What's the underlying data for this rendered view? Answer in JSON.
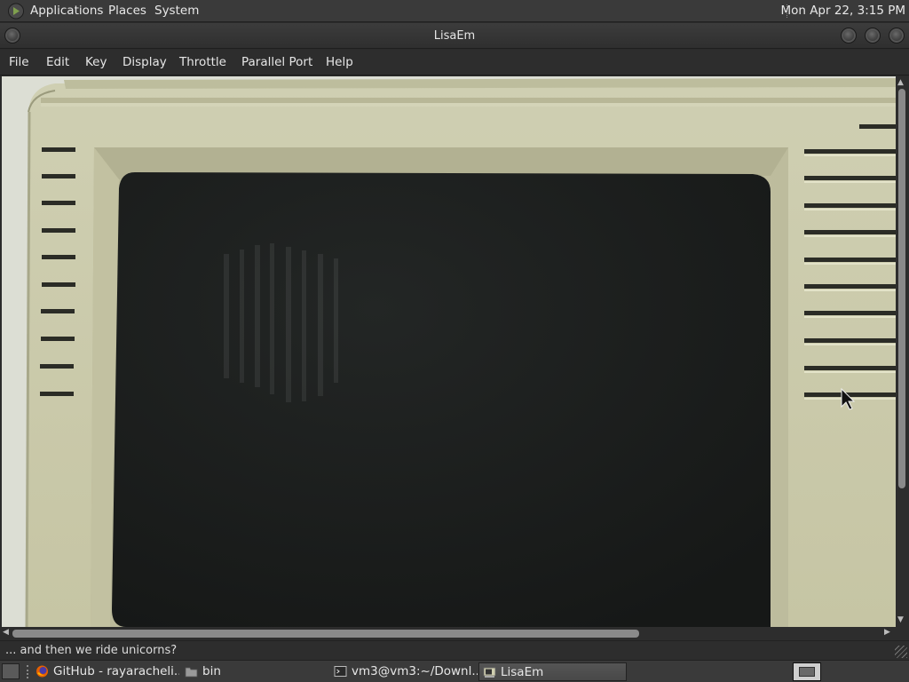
{
  "top_panel": {
    "menus": [
      "Applications",
      "Places",
      "System"
    ],
    "clock": "Mon Apr 22,  3:15 PM"
  },
  "window": {
    "title": "LisaEm"
  },
  "menubar": {
    "items": [
      "File",
      "Edit",
      "Key",
      "Display",
      "Throttle",
      "Parallel Port",
      "Help"
    ]
  },
  "statusbar": {
    "message": "... and then we ride unicorns?"
  },
  "taskbar": {
    "tasks": [
      {
        "label": "GitHub - rayaracheli...",
        "icon": "firefox-icon"
      },
      {
        "label": "bin",
        "icon": "folder-icon"
      },
      {
        "label": "vm3@vm3:~/Downl...",
        "icon": "terminal-icon"
      },
      {
        "label": "LisaEm",
        "icon": "lisaem-icon",
        "active": true
      }
    ]
  },
  "colors": {
    "panel": "#3a3a3a",
    "window_chrome": "#2d2d2d",
    "lisa_beige": "#c9c8a7",
    "crt_screen": "#1a1c1b"
  }
}
